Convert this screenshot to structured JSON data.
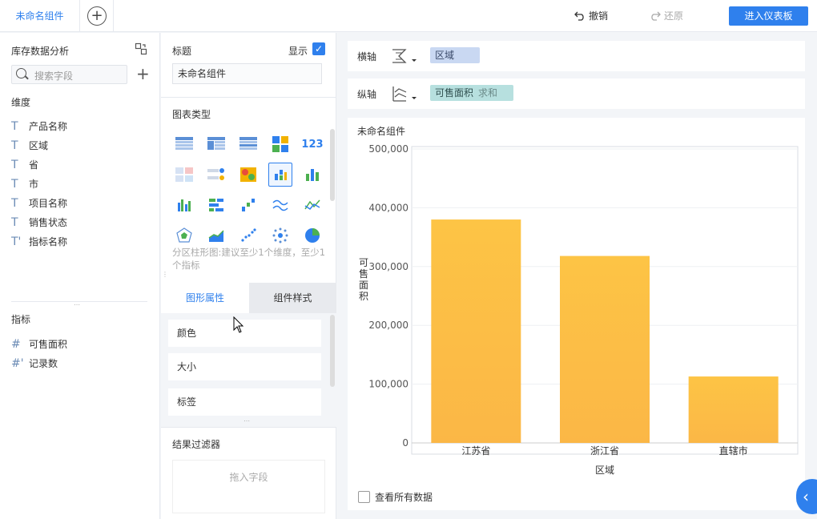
{
  "topbar": {
    "tab_label": "未命名组件",
    "undo_label": "撤销",
    "redo_label": "还原",
    "enter_label": "进入仪表板"
  },
  "left_panel": {
    "dataset_title": "库存数据分析",
    "search_placeholder": "搜索字段",
    "dimensions_title": "维度",
    "dimensions": [
      "产品名称",
      "区域",
      "省",
      "市",
      "项目名称",
      "销售状态",
      "指标名称"
    ],
    "measures_title": "指标",
    "measures": [
      "可售面积",
      "记录数"
    ]
  },
  "mid_panel": {
    "title_label": "标题",
    "show_label": "显示",
    "title_value": "未命名组件",
    "chart_type_label": "图表类型",
    "chart_hint": "分区柱形图:建议至少1个维度，至少1个指标",
    "tab_graph_props": "图形属性",
    "tab_component_style": "组件样式",
    "props": [
      "颜色",
      "大小",
      "标签"
    ],
    "filter_title": "结果过滤器",
    "drop_field": "拖入字段"
  },
  "right_panel": {
    "x_axis_label": "横轴",
    "x_field": "区域",
    "y_axis_label": "纵轴",
    "y_field": "可售面积",
    "y_agg": "求和",
    "component_title": "未命名组件",
    "view_all_label": "查看所有数据"
  },
  "colors": {
    "accent": "#2f80ed",
    "bar": "#fdc445"
  },
  "chart_data": {
    "type": "bar",
    "categories": [
      "江苏省",
      "浙江省",
      "直辖市"
    ],
    "values": [
      380000,
      318000,
      113000
    ],
    "xlabel": "区域",
    "ylabel": "可售面积",
    "ylim": [
      0,
      500000
    ],
    "yticks": [
      "0",
      "100,000",
      "200,000",
      "300,000",
      "400,000",
      "500,000"
    ]
  }
}
